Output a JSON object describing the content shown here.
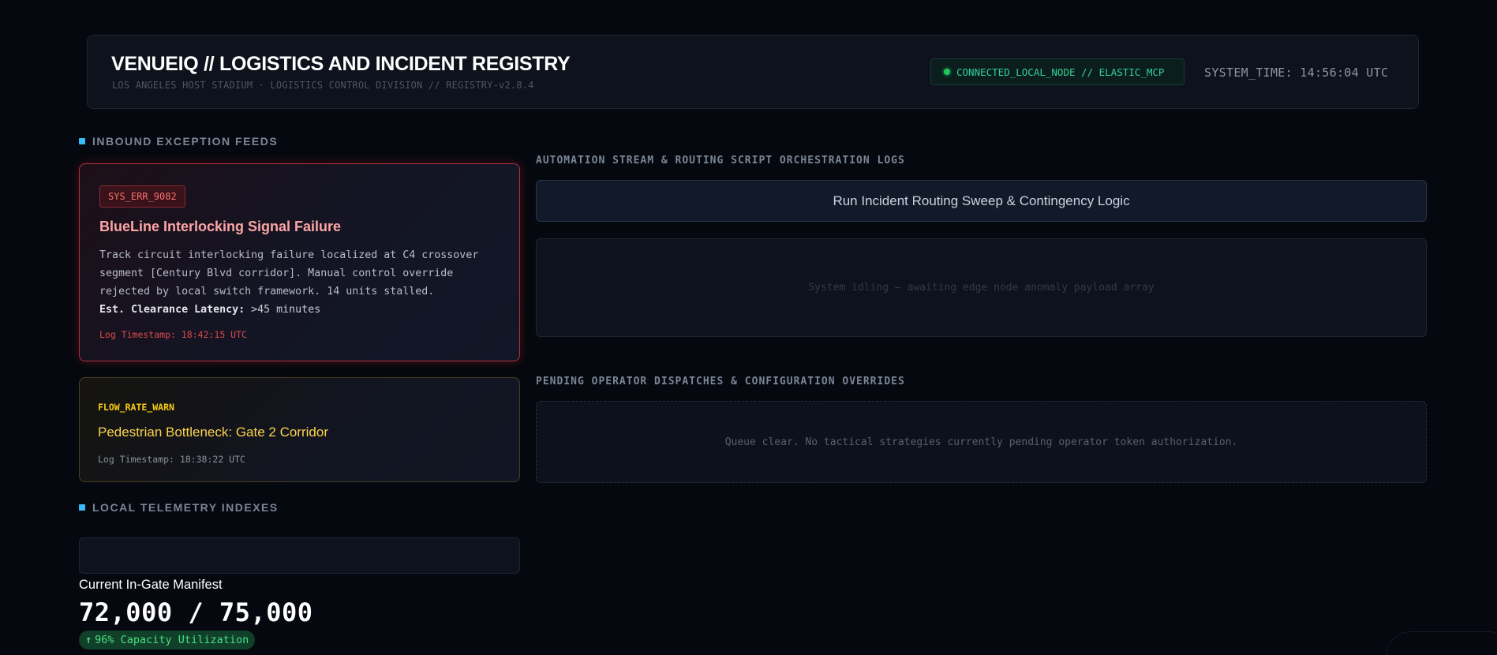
{
  "header": {
    "title": "VENUEIQ // LOGISTICS AND INCIDENT REGISTRY",
    "subtitle": "LOS ANGELES HOST STADIUM · LOGISTICS CONTROL DIVISION // REGISTRY-v2.8.4",
    "connection_status": "CONNECTED_LOCAL_NODE // ELASTIC_MCP",
    "system_time": "SYSTEM_TIME: 14:56:04 UTC"
  },
  "exception_feeds": {
    "heading": "INBOUND EXCEPTION FEEDS",
    "critical": {
      "code": "SYS_ERR_9082",
      "title": "BlueLine Interlocking Signal Failure",
      "description": "Track circuit interlocking failure localized at C4 crossover segment [Century Blvd corridor]. Manual control override rejected by local switch framework. 14 units stalled.",
      "latency_label": "Est. Clearance Latency:",
      "latency_value": ">45 minutes",
      "timestamp": "Log Timestamp: 18:42:15 UTC"
    },
    "warning": {
      "code": "FLOW_RATE_WARN",
      "title": "Pedestrian Bottleneck: Gate 2 Corridor",
      "timestamp": "Log Timestamp: 18:38:22 UTC"
    }
  },
  "telemetry": {
    "heading": "LOCAL TELEMETRY INDEXES",
    "manifest_label": "Current In-Gate Manifest",
    "manifest_value": "72,000 / 75,000",
    "capacity_text": "96% Capacity Utilization",
    "capacity_percent": 96
  },
  "automation": {
    "heading": "AUTOMATION STREAM & ROUTING SCRIPT ORCHESTRATION LOGS",
    "run_button": "Run Incident Routing Sweep & Contingency Logic",
    "idle_message": "System idling — awaiting edge node anomaly payload array"
  },
  "dispatches": {
    "heading": "PENDING OPERATOR DISPATCHES & CONFIGURATION OVERRIDES",
    "empty_message": "Queue clear. No tactical strategies currently pending operator token authorization."
  },
  "colors": {
    "background": "#05080f",
    "critical": "#f87171",
    "warning": "#facc15",
    "success": "#4ade80",
    "accent": "#38bdf8"
  },
  "icons": {
    "status": "status-dot-icon",
    "section": "section-bullet-icon",
    "capacity": "arrow-up-icon"
  }
}
